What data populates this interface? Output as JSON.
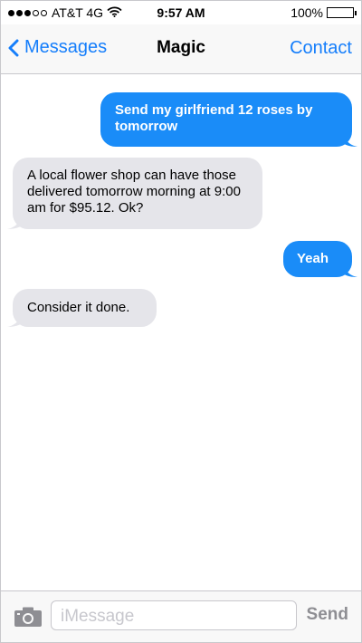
{
  "status_bar": {
    "signal_dots_filled": 3,
    "signal_dots_total": 5,
    "carrier": "AT&T 4G",
    "time": "9:57 AM",
    "battery_percent": "100%",
    "wifi_icon": "wifi-icon",
    "battery_icon": "battery-icon"
  },
  "nav": {
    "back_label": "Messages",
    "back_icon": "chevron-left-icon",
    "title": "Magic",
    "contact_label": "Contact"
  },
  "messages": [
    {
      "direction": "sent",
      "text": "Send my girlfriend 12 roses by tomorrow"
    },
    {
      "direction": "received",
      "text": "A local flower shop can have those delivered tomorrow morning at 9:00 am for $95.12. Ok?"
    },
    {
      "direction": "sent",
      "text": "Yeah"
    },
    {
      "direction": "received",
      "text": "Consider it done."
    }
  ],
  "compose": {
    "camera_icon": "camera-icon",
    "placeholder": "iMessage",
    "send_label": "Send"
  },
  "colors": {
    "accent": "#157efb",
    "sent_bubble": "#1a8cf8",
    "received_bubble": "#e5e5ea",
    "send_disabled": "#8e8e93"
  }
}
